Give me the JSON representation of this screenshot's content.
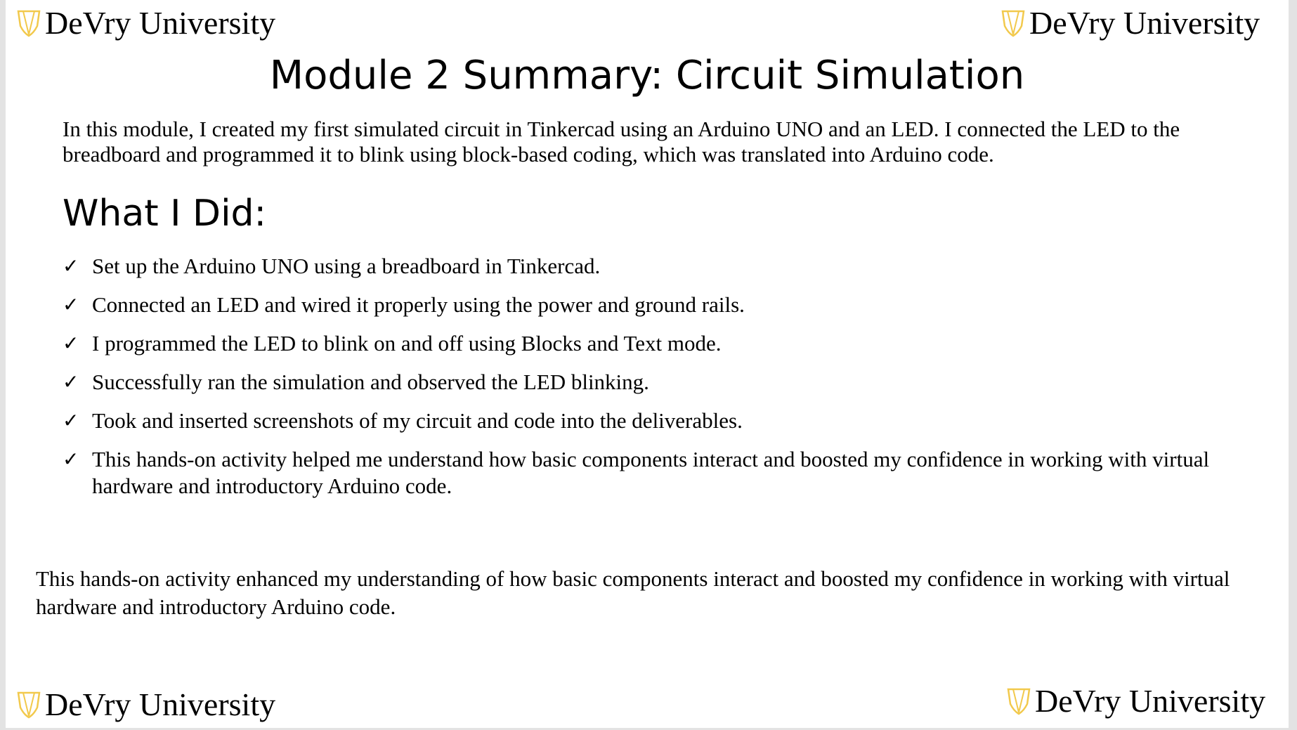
{
  "branding": {
    "logo_text": "DeVry University",
    "logo_color": "#f2c94c",
    "logo_icon": "devry-shield-icon"
  },
  "title": "Module 2 Summary: Circuit Simulation",
  "intro": "In this module, I created my first simulated circuit in Tinkercad using an Arduino UNO and an LED. I connected the LED to the breadboard and programmed it to blink using block-based coding, which was translated into Arduino code.",
  "section_heading": "What I Did:",
  "check_mark": "✓",
  "bullets": [
    "Set up the Arduino UNO using a breadboard in Tinkercad.",
    "Connected an LED and wired it properly using the power and ground rails.",
    "I programmed the LED to blink on and off using Blocks and Text mode.",
    "Successfully ran the simulation and observed the LED blinking.",
    "Took and inserted screenshots of my circuit and code into the deliverables.",
    "This hands-on activity helped me understand how basic components interact and boosted my confidence in working with virtual hardware and introductory Arduino code."
  ],
  "closing": "This hands-on activity enhanced my understanding of how basic components interact and boosted my confidence in working with virtual hardware and introductory Arduino code."
}
